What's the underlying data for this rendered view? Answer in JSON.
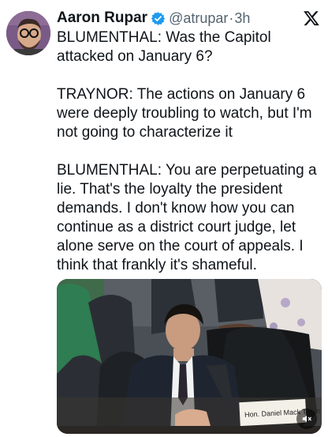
{
  "author": {
    "name": "Aaron Rupar",
    "handle": "@atrupar",
    "separator": "·",
    "time": "3h",
    "verified": true
  },
  "icons": {
    "avatar": "avatar-image",
    "verified": "verified-badge-icon",
    "platform": "x-logo-icon",
    "mute": "volume-muted-icon"
  },
  "tweet": {
    "paragraphs": [
      "BLUMENTHAL: Was the Capitol attacked on January 6?",
      "TRAYNOR: The actions on January 6 were deeply troubling to watch, but I'm not going to characterize it",
      "BLUMENTHAL: You are perpetuating a lie. That's the loyalty the president demands. I don't know how you can continue as a district court judge, let alone serve on the court of appeals. I think that frankly it's shameful."
    ]
  },
  "media": {
    "nameplate": "Hon. Daniel Mack Trayn"
  },
  "colors": {
    "text": "#0f1419",
    "secondary": "#536471",
    "verified_blue": "#1d9bf0"
  }
}
